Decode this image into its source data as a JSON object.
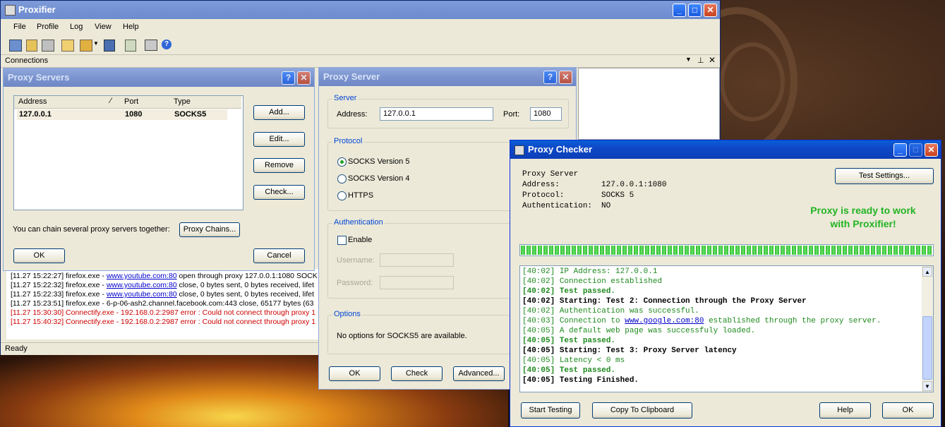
{
  "main": {
    "title": "Proxifier",
    "menu": [
      "File",
      "Profile",
      "Log",
      "View",
      "Help"
    ],
    "connections_label": "Connections",
    "status": "Ready",
    "log_lines": [
      {
        "time": "[11.27 15:22:27]",
        "prefix": " firefox.exe - ",
        "link": "www.youtube.com:80",
        "rest": " open through proxy 127.0.0.1:1080 SOCK",
        "color": "#000000"
      },
      {
        "time": "[11.27 15:22:32]",
        "prefix": " firefox.exe - ",
        "link": "www.youtube.com:80",
        "rest": " close, 0 bytes sent, 0 bytes received, lifet",
        "color": "#000000"
      },
      {
        "time": "[11.27 15:22:33]",
        "prefix": " firefox.exe - ",
        "link": "www.youtube.com:80",
        "rest": " close, 0 bytes sent, 0 bytes received, lifet",
        "color": "#000000"
      },
      {
        "time": "[11.27 15:23:51]",
        "prefix": " firefox.exe - 6-p-06-ash2.channel.facebook.com:443 close, 65177 bytes (63",
        "link": "",
        "rest": "",
        "color": "#000000"
      },
      {
        "time": "[11.27 15:30:30]",
        "prefix": " Connectify.exe - 192.168.0.2:2987 error : Could not connect through proxy 1",
        "link": "",
        "rest": "",
        "color": "#cc0000"
      },
      {
        "time": "[11.27 15:40:32]",
        "prefix": " Connectify.exe - 192.168.0.2:2987 error : Could not connect through proxy 1",
        "link": "",
        "rest": "",
        "color": "#cc0000"
      }
    ]
  },
  "proxy_servers": {
    "title": "Proxy Servers",
    "columns": [
      "Address",
      "Port",
      "Type"
    ],
    "rows": [
      {
        "address": "127.0.0.1",
        "port": "1080",
        "type": "SOCKS5"
      }
    ],
    "buttons": {
      "add": "Add...",
      "edit": "Edit...",
      "remove": "Remove",
      "check": "Check..."
    },
    "chain_text": "You can chain several proxy servers together:",
    "chain_button": "Proxy Chains...",
    "ok": "OK",
    "cancel": "Cancel"
  },
  "proxy_server": {
    "title": "Proxy Server",
    "server_group": "Server",
    "address_label": "Address:",
    "address_value": "127.0.0.1",
    "port_label": "Port:",
    "port_value": "1080",
    "protocol_group": "Protocol",
    "protocols": [
      "SOCKS Version 5",
      "SOCKS Version 4",
      "HTTPS"
    ],
    "selected_protocol": "SOCKS Version 5",
    "auth_group": "Authentication",
    "enable_label": "Enable",
    "username_label": "Username:",
    "password_label": "Password:",
    "options_group": "Options",
    "options_text": "No options for SOCKS5 are available.",
    "ok": "OK",
    "check": "Check",
    "advanced": "Advanced..."
  },
  "checker": {
    "title": "Proxy Checker",
    "info": [
      {
        "k": "Proxy Server",
        "v": ""
      },
      {
        "k": "Address:",
        "v": "127.0.0.1:1080"
      },
      {
        "k": "Protocol:",
        "v": "SOCKS 5"
      },
      {
        "k": "Authentication:",
        "v": "NO"
      }
    ],
    "test_settings": "Test Settings...",
    "ready_line1": "Proxy is ready to work",
    "ready_line2": "with Proxifier!",
    "progress": 1.0,
    "log": [
      {
        "t": "[40:02]",
        "text": " IP Address: 127.0.0.1",
        "style": "green"
      },
      {
        "t": "[40:02]",
        "text": " Connection established",
        "style": "green"
      },
      {
        "t": "[40:02]",
        "text": " Test passed.",
        "style": "green-bold"
      },
      {
        "t": "[40:02]",
        "text": " Starting: Test 2: Connection through the Proxy Server",
        "style": "black-bold"
      },
      {
        "t": "[40:02]",
        "text": " Authentication was successful.",
        "style": "green"
      },
      {
        "t": "[40:03]",
        "text": " Connection to ",
        "link": "www.google.com:80",
        "after": " established through the proxy server.",
        "style": "green"
      },
      {
        "t": "[40:05]",
        "text": " A default web page was successfuly loaded.",
        "style": "green"
      },
      {
        "t": "[40:05]",
        "text": " Test passed.",
        "style": "green-bold"
      },
      {
        "t": "[40:05]",
        "text": " Starting: Test 3: Proxy Server latency",
        "style": "black-bold"
      },
      {
        "t": "[40:05]",
        "text": " Latency < 0 ms",
        "style": "green"
      },
      {
        "t": "[40:05]",
        "text": " Test passed.",
        "style": "green-bold"
      },
      {
        "t": "[40:05]",
        "text": " Testing Finished.",
        "style": "black-bold"
      }
    ],
    "buttons": {
      "start": "Start Testing",
      "copy": "Copy To Clipboard",
      "help": "Help",
      "ok": "OK"
    }
  },
  "colors": {
    "titlebar": "#0b4fd0",
    "ready_green": "#22b322",
    "log_green": "#1f8a1f",
    "error_red": "#cc0000"
  }
}
